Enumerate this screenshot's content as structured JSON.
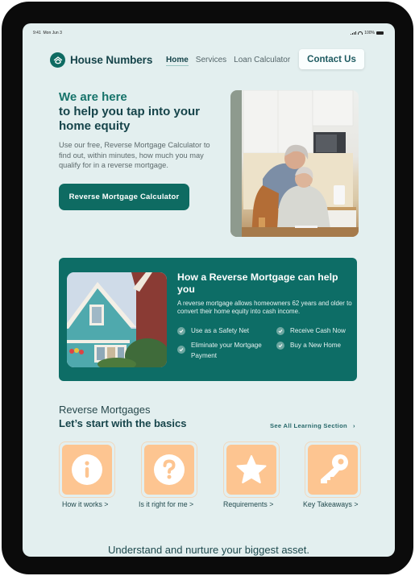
{
  "status_bar": {
    "time": "9:41",
    "date": "Mon Jun 3",
    "battery": "100%"
  },
  "nav": {
    "brand": "House Numbers",
    "links": [
      {
        "label": "Home",
        "active": true
      },
      {
        "label": "Services",
        "active": false
      },
      {
        "label": "Loan Calculator",
        "active": false
      }
    ],
    "contact_label": "Contact Us"
  },
  "hero": {
    "eyebrow": "We are here",
    "title": "to help you tap into your home equity",
    "description": "Use our free, Reverse Mortgage Calculator to find out, within minutes, how much you may qualify for in a reverse mortgage.",
    "cta_label": "Reverse Mortgage Calculator",
    "image_alt": "Senior couple reviewing paperwork in kitchen"
  },
  "reverse_card": {
    "title": "How a Reverse Mortgage  can help you",
    "description": "A reverse mortgage allows homeowners 62 years and older to convert their home equity into cash income.",
    "features": [
      "Use as a Safety Net",
      "Receive Cash Now",
      "Eliminate your Mortgage Payment",
      "Buy a New Home"
    ],
    "image_alt": "Teal Victorian house"
  },
  "basics": {
    "eyebrow": "Reverse Mortgages",
    "title": "Let’s start with the basics",
    "see_all_label": "See All Learning Section",
    "tiles": [
      {
        "label": "How it works >",
        "icon": "info-icon"
      },
      {
        "label": "Is it right for me >",
        "icon": "question-icon"
      },
      {
        "label": "Requirements >",
        "icon": "star-icon"
      },
      {
        "label": "Key Takeaways >",
        "icon": "key-icon"
      }
    ]
  },
  "tagline": "Understand and nurture your biggest asset.",
  "colors": {
    "brand_teal": "#0e6b62",
    "heading_dark": "#16444a",
    "background": "#e3efef",
    "tile_orange": "#fdc591"
  }
}
